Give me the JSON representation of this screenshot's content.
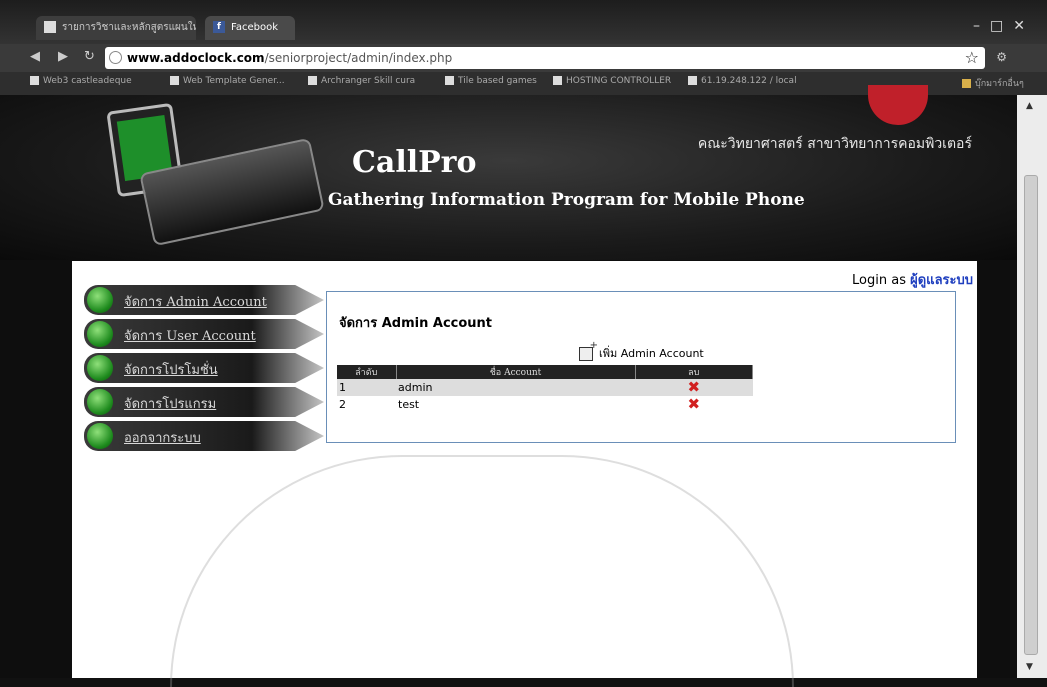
{
  "browser": {
    "tabs": [
      {
        "label": "รายการวิชาและหลักสูตรแผนใหม่"
      },
      {
        "label": "Facebook"
      }
    ],
    "url_host": "www.addoclock.com",
    "url_path": "/seniorproject/admin/index.php",
    "bookmarks": [
      "Web3 castleadeque",
      "Web Template Gener...",
      "Archranger Skill cura",
      "Tile based games",
      "HOSTING CONTROLLER",
      "61.19.248.122 / local",
      "บุ๊กมาร์กอื่นๆ"
    ]
  },
  "header": {
    "faculty": "คณะวิทยาศาสตร์ สาขาวิทยาการคอมพิวเตอร์",
    "title": "CallPro",
    "subtitle": "Gathering Information Program for Mobile Phone"
  },
  "login": {
    "prefix": "Login as",
    "user": "ผู้ดูแลระบบ"
  },
  "menu": {
    "items": [
      {
        "label": "จัดการ Admin Account"
      },
      {
        "label": "จัดการ User Account"
      },
      {
        "label": "จัดการโปรโมชั่น"
      },
      {
        "label": "จัดการโปรแกรม"
      },
      {
        "label": "ออกจากระบบ"
      }
    ]
  },
  "panel": {
    "title": "จัดการ Admin Account",
    "add_label": "เพิ่ม Admin Account",
    "columns": [
      "ลำดับ",
      "ชื่อ Account",
      "ลบ"
    ],
    "rows": [
      {
        "num": "1",
        "name": "admin"
      },
      {
        "num": "2",
        "name": "test"
      }
    ]
  }
}
